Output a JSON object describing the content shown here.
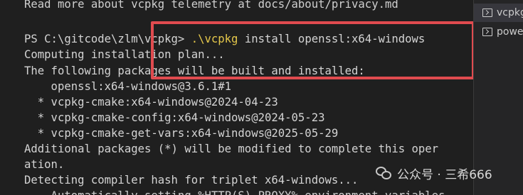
{
  "terminal": {
    "lines": [
      "Read more about vcpkg telemetry at docs/about/privacy.md",
      "",
      "Computing installation plan...",
      "The following packages will be built and installed:",
      "    openssl:x64-windows@3.6.1#1",
      "  * vcpkg-cmake:x64-windows@2024-04-23",
      "  * vcpkg-cmake-config:x64-windows@2024-05-23",
      "  * vcpkg-cmake-get-vars:x64-windows@2025-05-29",
      "Additional packages (*) will be modified to complete this oper",
      "ation.",
      "Detecting compiler hash for triplet x64-windows...",
      "    Automatically setting %HTTP(S)_PROXY% environment variables"
    ],
    "prompt": "PS C:\\gitcode\\zlm\\vcpkg> ",
    "command_exe": ".\\vcpkg",
    "command_args": " install openssl:x64-windows"
  },
  "side_panel": {
    "items": [
      {
        "label": "vcpkg",
        "icon": "terminal-icon",
        "active": true
      },
      {
        "label": "powe",
        "icon": "terminal-icon",
        "active": false
      }
    ]
  },
  "watermark": {
    "text": "公众号 · 三希666"
  },
  "colors": {
    "highlight": "#e04b4f",
    "command": "#e5c84b"
  }
}
